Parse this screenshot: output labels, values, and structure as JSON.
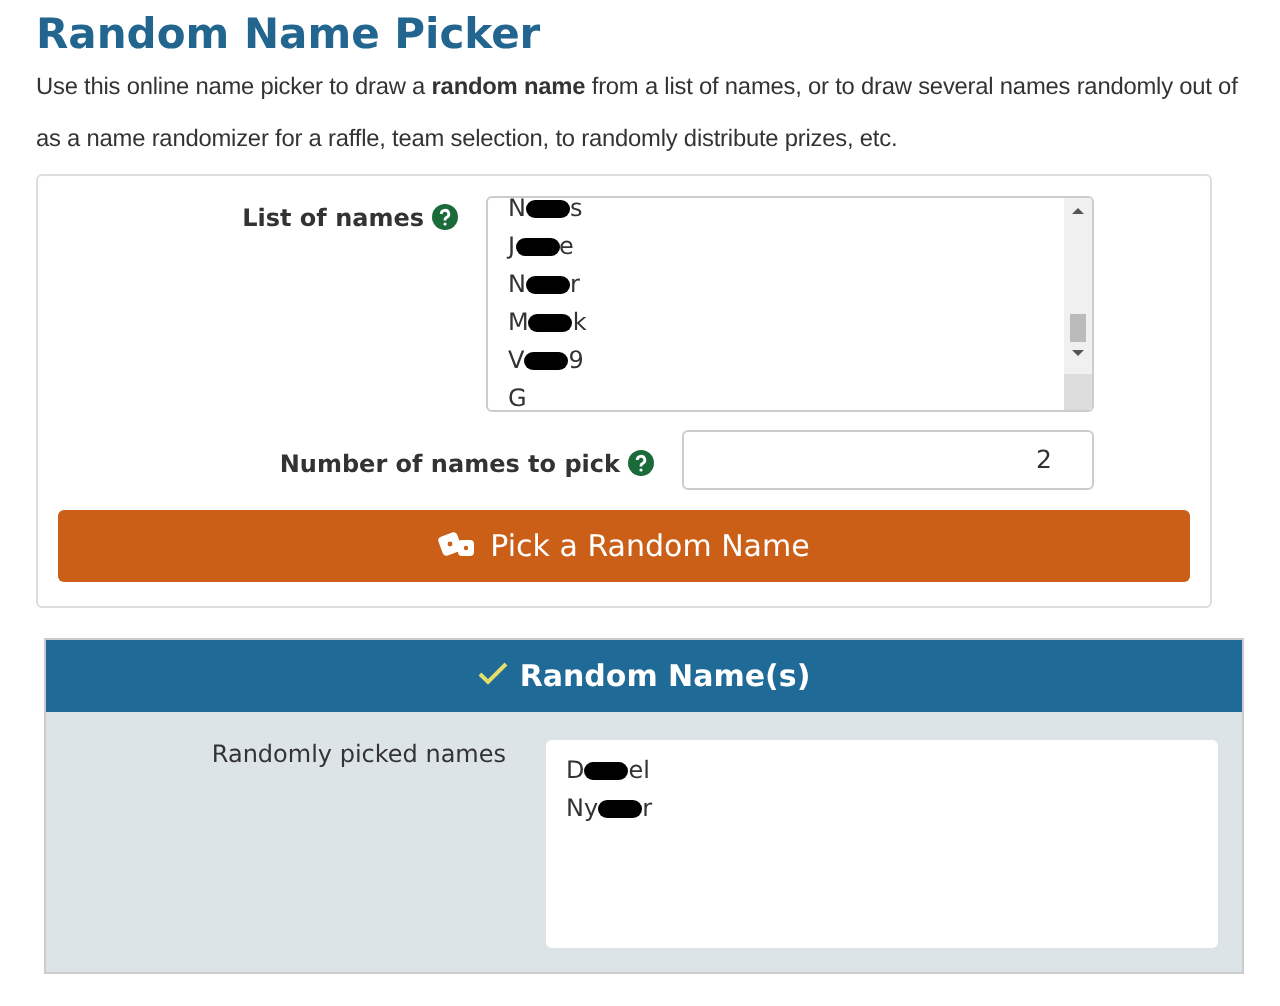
{
  "page": {
    "title": "Random Name Picker",
    "intro_lines": [
      "Use this online name picker to draw a **random name** from a list of names, or to draw several names randomly out of",
      "as a name randomizer for a raffle, team selection, to randomly distribute prizes, etc."
    ]
  },
  "picker": {
    "list_label": "List of names",
    "names": [
      {
        "start": "N",
        "end": "s",
        "redacted": true
      },
      {
        "start": "J",
        "end": "e",
        "redacted": true
      },
      {
        "start": "N",
        "end": "r",
        "redacted": true
      },
      {
        "start": "M",
        "end": "k",
        "redacted": true
      },
      {
        "start": "V",
        "end": "9",
        "redacted": true
      },
      {
        "start": "G",
        "redacted": false
      }
    ],
    "count_label": "Number of names to pick",
    "count_value": "2",
    "button": "Pick a Random Name"
  },
  "result": {
    "title": "Random Name(s)",
    "label": "Randomly picked names",
    "names": [
      {
        "start": "D",
        "end": "el",
        "redacted": true
      },
      {
        "start": "Ny",
        "end": "r",
        "redacted": true
      }
    ]
  }
}
